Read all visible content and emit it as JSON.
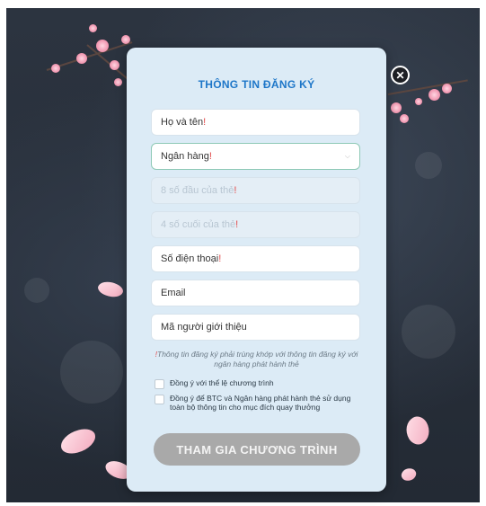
{
  "form": {
    "title": "THÔNG TIN ĐĂNG KÝ",
    "full_name_placeholder": "Họ và tên",
    "bank_placeholder": "Ngân hàng",
    "card_first8_placeholder": "8 số đầu của thẻ",
    "card_last4_placeholder": "4 số cuối của thẻ",
    "phone_placeholder": "Số điện thoại",
    "email_placeholder": "Email",
    "referrer_placeholder": "Mã người giới thiệu",
    "required_mark": "!",
    "note_mark": "!",
    "note_text": "Thông tin đăng ký phải trùng khớp với thông tin đăng ký với ngân hàng phát hành thẻ",
    "agree_terms_label": "Đồng ý với thể lệ chương trình",
    "agree_data_label": "Đồng ý để BTC và Ngân hàng phát hành thẻ sử dụng toàn bộ thông tin cho mục đích quay thưởng",
    "submit_label": "THAM GIA CHƯƠNG TRÌNH"
  },
  "icons": {
    "close": "close-icon",
    "dropdown": "chevron-down-icon"
  },
  "colors": {
    "title": "#1d76c8",
    "modal_bg": "#dcebf6",
    "required": "#e24a4a",
    "button_disabled": "#a9a9a9"
  }
}
